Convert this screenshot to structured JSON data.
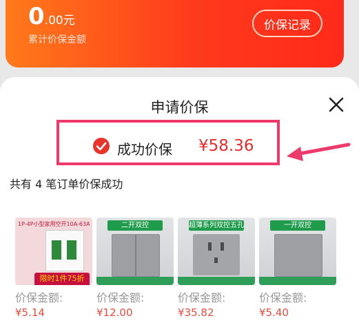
{
  "header": {
    "amount_int": "0",
    "amount_frac": ".00元",
    "cumulative_label": "累计价保金额",
    "record_button": "价保记录",
    "accent_color": "#ff3a1c"
  },
  "sheet": {
    "title": "申请价保",
    "close_icon": "close-icon",
    "status_text": "成功价保",
    "status_amount": "¥58.36",
    "status_icon": "check-circle-icon",
    "highlight_color": "#ee3a6b",
    "summary": "共有 4 笔订单价保成功"
  },
  "items": [
    {
      "image_text": "1P-4P小型家用空开10A-63A",
      "promo": "限时1件75折",
      "label": "价保金额:",
      "price": "¥5.14"
    },
    {
      "image_text": "二开双控",
      "label": "价保金额:",
      "price": "¥12.00"
    },
    {
      "image_text": "超薄系列双控五孔",
      "label": "价保金额:",
      "price": "¥35.82"
    },
    {
      "image_text": "一开双控",
      "label": "价保金额:",
      "price": "¥5.40"
    }
  ]
}
